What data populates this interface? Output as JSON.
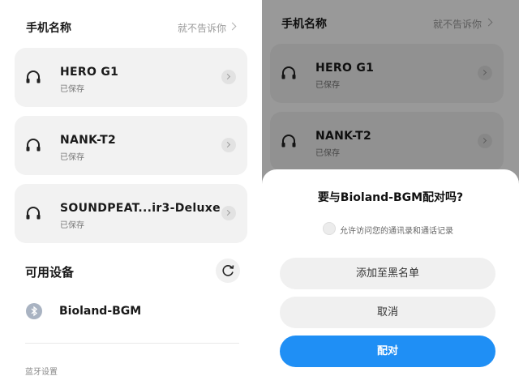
{
  "left": {
    "header": {
      "title": "手机名称",
      "value": "就不告诉你"
    },
    "devices": [
      {
        "name": "HERO G1",
        "status": "已保存",
        "icon": "headphones-icon"
      },
      {
        "name": "NANK-T2",
        "status": "已保存",
        "icon": "headphones-icon"
      },
      {
        "name": "SOUNDPEAT...ir3-Deluxe",
        "status": "已保存",
        "icon": "headphones-icon"
      }
    ],
    "available": {
      "title": "可用设备",
      "refresh_icon": "refresh-icon"
    },
    "available_devices": [
      {
        "name": "Bioland-BGM",
        "icon": "bluetooth-icon"
      }
    ],
    "footer": {
      "link": "蓝牙设置"
    }
  },
  "right": {
    "header": {
      "title": "手机名称",
      "value": "就不告诉你"
    },
    "devices": [
      {
        "name": "HERO G1",
        "status": "已保存",
        "icon": "headphones-icon"
      },
      {
        "name": "NANK-T2",
        "status": "已保存",
        "icon": "headphones-icon"
      }
    ],
    "dialog": {
      "title": "要与Bioland-BGM配对吗?",
      "permission": "允许访问您的通讯录和通话记录",
      "permission_checked": false,
      "buttons": {
        "blacklist": "添加至黑名单",
        "cancel": "取消",
        "pair": "配对"
      }
    }
  },
  "colors": {
    "accent": "#1f8ff5",
    "card_bg": "#f2f2f2",
    "dim_overlay": "rgba(0,0,0,0.40)"
  }
}
